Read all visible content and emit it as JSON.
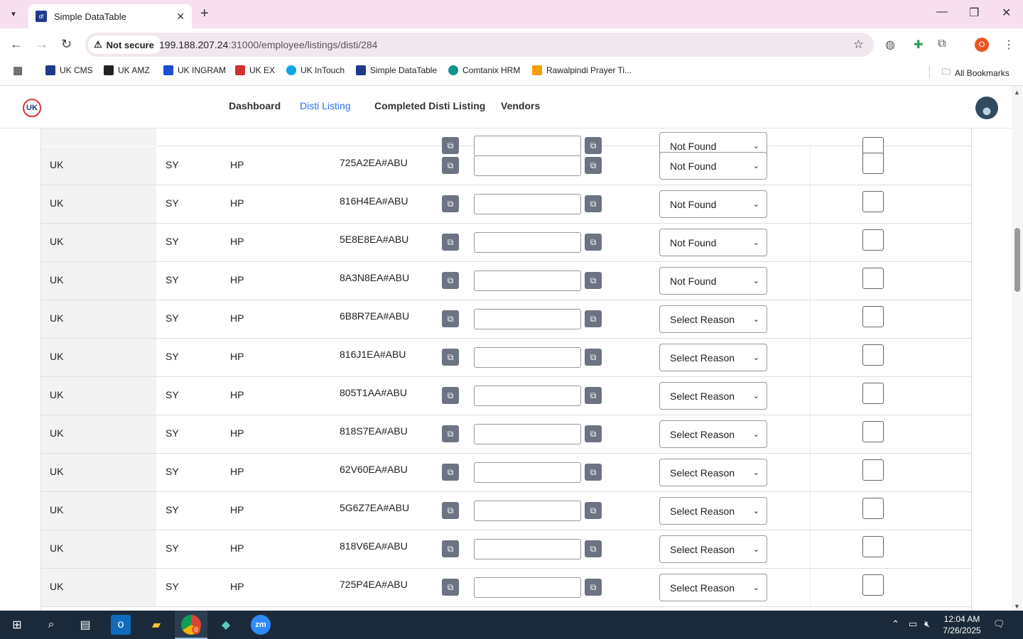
{
  "browser": {
    "tab_title": "Simple DataTable",
    "tab_favicon": "df",
    "security_label": "Not secure",
    "url_host": "199.188.207.24",
    "url_rest": ":31000/employee/listings/disti/284",
    "profile_initial": "O"
  },
  "bookmarks": [
    {
      "label": "UK CMS",
      "color": "#1f3a8a"
    },
    {
      "label": "UK AMZ",
      "color": "#222222"
    },
    {
      "label": "UK INGRAM",
      "color": "#1d4ed8"
    },
    {
      "label": "UK EX",
      "color": "#d32f2f"
    },
    {
      "label": "UK InTouch",
      "color": "#0ea5e9"
    },
    {
      "label": "Simple DataTable",
      "color": "#1f3a8a"
    },
    {
      "label": "Comtanix HRM",
      "color": "#0d9488"
    },
    {
      "label": "Rawalpindi Prayer Ti...",
      "color": "#f59e0b"
    }
  ],
  "all_bookmarks_label": "All Bookmarks",
  "nav": {
    "logo": "UK",
    "links": [
      "Dashboard",
      "Disti Listing",
      "Completed Disti Listing",
      "Vendors"
    ],
    "active": "Disti Listing"
  },
  "rows": [
    {
      "country": "UK",
      "code": "SY",
      "brand": "HP",
      "sku": "725A2EA#ABU",
      "reason": "Not Found"
    },
    {
      "country": "UK",
      "code": "SY",
      "brand": "HP",
      "sku": "816H4EA#ABU",
      "reason": "Not Found"
    },
    {
      "country": "UK",
      "code": "SY",
      "brand": "HP",
      "sku": "5E8E8EA#ABU",
      "reason": "Not Found"
    },
    {
      "country": "UK",
      "code": "SY",
      "brand": "HP",
      "sku": "8A3N8EA#ABU",
      "reason": "Not Found"
    },
    {
      "country": "UK",
      "code": "SY",
      "brand": "HP",
      "sku": "6B8R7EA#ABU",
      "reason": "Select Reason"
    },
    {
      "country": "UK",
      "code": "SY",
      "brand": "HP",
      "sku": "816J1EA#ABU",
      "reason": "Select Reason"
    },
    {
      "country": "UK",
      "code": "SY",
      "brand": "HP",
      "sku": "805T1AA#ABU",
      "reason": "Select Reason"
    },
    {
      "country": "UK",
      "code": "SY",
      "brand": "HP",
      "sku": "818S7EA#ABU",
      "reason": "Select Reason"
    },
    {
      "country": "UK",
      "code": "SY",
      "brand": "HP",
      "sku": "62V60EA#ABU",
      "reason": "Select Reason"
    },
    {
      "country": "UK",
      "code": "SY",
      "brand": "HP",
      "sku": "5G6Z7EA#ABU",
      "reason": "Select Reason"
    },
    {
      "country": "UK",
      "code": "SY",
      "brand": "HP",
      "sku": "818V6EA#ABU",
      "reason": "Select Reason"
    },
    {
      "country": "UK",
      "code": "SY",
      "brand": "HP",
      "sku": "725P4EA#ABU",
      "reason": "Select Reason"
    }
  ],
  "partial_top_reason": "Not Found",
  "taskbar": {
    "time": "12:04 AM",
    "date": "7/26/2025",
    "chrome_badge": "0"
  }
}
